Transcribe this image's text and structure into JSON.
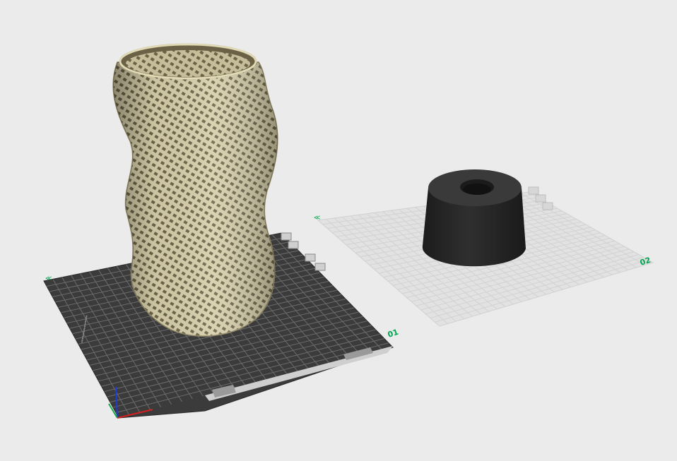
{
  "scene": {
    "background": "#ebebeb",
    "accent": "#00a651",
    "plates": [
      {
        "name": "plate-01",
        "label": "01",
        "state": "active",
        "color": "#3a3a3a"
      },
      {
        "name": "plate-02",
        "label": "02",
        "state": "inactive",
        "color": "#dcdcdc"
      }
    ],
    "objects": [
      {
        "name": "twisted-lattice-vase",
        "plate": "01",
        "color": "#c9c19a"
      },
      {
        "name": "cylinder-spacer",
        "plate": "02",
        "color": "#2b2b2b"
      }
    ],
    "plate_icons": [
      "select-plate-icon",
      "lock-icon",
      "arrange-icon",
      "orient-icon",
      "settings-icon"
    ]
  }
}
